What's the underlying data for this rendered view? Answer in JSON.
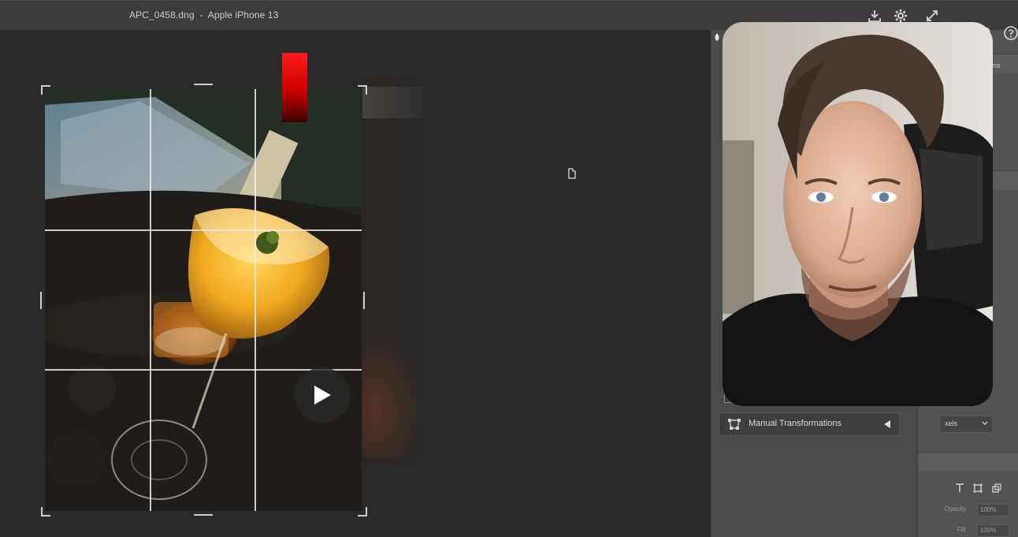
{
  "window": {
    "title": "APC_0458.dng  -  Apple iPhone 13",
    "icons": [
      "download-icon",
      "gear-icon",
      "expand-icon",
      "search-icon",
      "help-icon"
    ]
  },
  "canvas": {
    "crop_grid": {
      "rows": 3,
      "cols": 3
    },
    "overlay": {
      "play_icon": "play-icon"
    }
  },
  "panel": {
    "manual_transformations_label": "Manual Transformations",
    "dropdown_partial": "xels",
    "partial_tab_label": "ns",
    "field_opacity_label": "Opacity",
    "field_opacity_value": "100%",
    "field_fill_label": "Fill",
    "field_fill_value": "100%"
  },
  "colors": {
    "titlebar": "#3c3c3c",
    "canvas": "#2a2a2a",
    "panel": "#4a4a4a",
    "accent_red": "#ff1a1a"
  }
}
